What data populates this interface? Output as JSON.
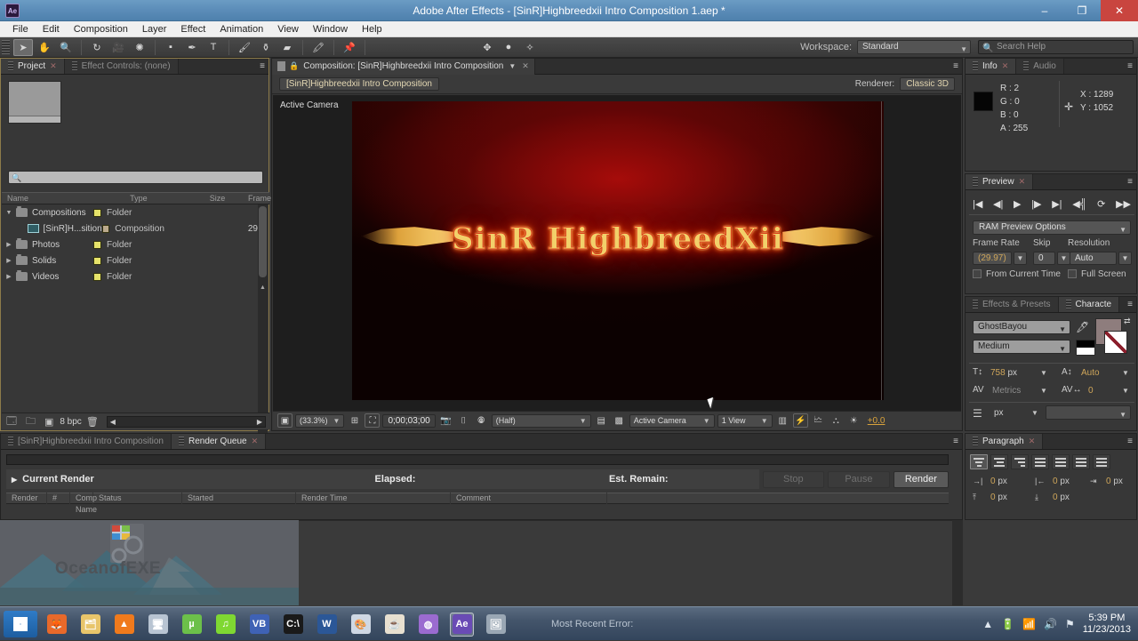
{
  "window": {
    "title": "Adobe After Effects - [SinR]Highbreedxii Intro Composition 1.aep *",
    "app_badge": "Ae",
    "minimize": "–",
    "maximize": "❐",
    "close": "✕"
  },
  "menubar": {
    "items": [
      "File",
      "Edit",
      "Composition",
      "Layer",
      "Effect",
      "Animation",
      "View",
      "Window",
      "Help"
    ]
  },
  "toolbar": {
    "tools": [
      {
        "name": "selection-tool",
        "glyph": "➤",
        "selected": true
      },
      {
        "name": "hand-tool",
        "glyph": "✋",
        "selected": false
      },
      {
        "name": "zoom-tool",
        "glyph": "🔍",
        "selected": false
      },
      {
        "name": "rotation-tool",
        "glyph": "↻",
        "selected": false
      },
      {
        "name": "camera-tool",
        "glyph": "🎥",
        "selected": false
      },
      {
        "name": "pan-behind-tool",
        "glyph": "✺",
        "selected": false
      },
      {
        "name": "shape-tool",
        "glyph": "▪",
        "selected": false
      },
      {
        "name": "pen-tool",
        "glyph": "✒",
        "selected": false
      },
      {
        "name": "type-tool",
        "glyph": "T",
        "selected": false
      },
      {
        "name": "brush-tool",
        "glyph": "🖌",
        "selected": false
      },
      {
        "name": "clone-stamp-tool",
        "glyph": "⚱",
        "selected": false
      },
      {
        "name": "eraser-tool",
        "glyph": "▰",
        "selected": false
      },
      {
        "name": "roto-brush-tool",
        "glyph": "🖍",
        "selected": false
      },
      {
        "name": "puppet-pin-tool",
        "glyph": "📌",
        "selected": false
      }
    ],
    "extra_tools": [
      {
        "name": "local-axis-mode-icon",
        "glyph": "✥"
      },
      {
        "name": "world-axis-mode-icon",
        "glyph": "●"
      },
      {
        "name": "view-axis-mode-icon",
        "glyph": "✧"
      }
    ],
    "workspace_label": "Workspace:",
    "workspace_value": "Standard",
    "search_placeholder": "Search Help"
  },
  "project_panel": {
    "tabs": [
      {
        "label": "Project",
        "active": true,
        "closable": true
      },
      {
        "label": "Effect Controls: (none)",
        "active": false,
        "closable": false
      }
    ],
    "search_placeholder": "",
    "columns": [
      "Name",
      "Type",
      "Size",
      "Frame"
    ],
    "rows": [
      {
        "name": "Compositions",
        "type": "Folder",
        "size": "",
        "frame": "",
        "indent": 0,
        "expanded": true,
        "kind": "folder"
      },
      {
        "name": "[SinR]H...sition",
        "type": "Composition",
        "size": "",
        "frame": "29",
        "indent": 1,
        "expanded": false,
        "kind": "comp"
      },
      {
        "name": "Photos",
        "type": "Folder",
        "size": "",
        "frame": "",
        "indent": 0,
        "expanded": false,
        "kind": "folder"
      },
      {
        "name": "Solids",
        "type": "Folder",
        "size": "",
        "frame": "",
        "indent": 0,
        "expanded": false,
        "kind": "folder"
      },
      {
        "name": "Videos",
        "type": "Folder",
        "size": "",
        "frame": "",
        "indent": 0,
        "expanded": false,
        "kind": "folder"
      }
    ],
    "bit_depth": "8 bpc"
  },
  "comp_panel": {
    "tab_label": "Composition: [SinR]Highbreedxii Intro Composition",
    "breadcrumb": "[SinR]Highbreedxii Intro Composition",
    "renderer_label": "Renderer:",
    "renderer_value": "Classic 3D",
    "view_label": "Active Camera",
    "canvas_title": "SinR HighbreedXii",
    "viewer_bar": {
      "zoom": "(33.3%)",
      "timecode": "0;00;03;00",
      "resolution": "(Half)",
      "camera": "Active Camera",
      "views": "1 View",
      "exposure": "+0.0"
    }
  },
  "info_panel": {
    "tabs": [
      {
        "label": "Info",
        "active": true,
        "closable": true
      },
      {
        "label": "Audio",
        "active": false,
        "closable": false
      }
    ],
    "r": "R : 2",
    "g": "G : 0",
    "b": "B : 0",
    "a": "A : 255",
    "x": "X : 1289",
    "y": "Y : 1052"
  },
  "preview_panel": {
    "tab": "Preview",
    "buttons": [
      {
        "name": "first-frame-button",
        "glyph": "|◀"
      },
      {
        "name": "previous-frame-button",
        "glyph": "◀|"
      },
      {
        "name": "play-button",
        "glyph": "▶"
      },
      {
        "name": "next-frame-button",
        "glyph": "|▶"
      },
      {
        "name": "last-frame-button",
        "glyph": "▶|"
      },
      {
        "name": "audio-button",
        "glyph": "◀╣"
      },
      {
        "name": "loop-button",
        "glyph": "⟳"
      },
      {
        "name": "ram-preview-button",
        "glyph": "▶▶"
      }
    ],
    "options_label": "RAM Preview Options",
    "frame_rate_label": "Frame Rate",
    "frame_rate_value": "(29.97)",
    "skip_label": "Skip",
    "skip_value": "0",
    "resolution_label": "Resolution",
    "resolution_value": "Auto",
    "from_current_time": "From Current Time",
    "full_screen": "Full Screen"
  },
  "character_panel": {
    "tabs": [
      {
        "label": "Effects & Presets",
        "active": false,
        "closable": false
      },
      {
        "label": "Characte",
        "active": true,
        "closable": false
      }
    ],
    "font_family": "GhostBayou",
    "font_style": "Medium",
    "font_size": "758",
    "font_size_unit": "px",
    "leading": "Auto",
    "kerning": "Metrics",
    "tracking": "0",
    "stroke_width_unit": "px",
    "fill_color": "#8e7d7d",
    "stroke_color": "#ffffff"
  },
  "paragraph_panel": {
    "tab": "Paragraph",
    "align_buttons": [
      {
        "name": "align-left-button",
        "active": true
      },
      {
        "name": "align-center-button",
        "active": false
      },
      {
        "name": "align-right-button",
        "active": false
      },
      {
        "name": "justify-last-left-button",
        "active": false
      },
      {
        "name": "justify-last-center-button",
        "active": false
      },
      {
        "name": "justify-last-right-button",
        "active": false
      },
      {
        "name": "justify-all-button",
        "active": false
      }
    ],
    "indent_left": "0",
    "indent_right": "0",
    "indent_first": "0",
    "space_before": "0",
    "space_after": "0",
    "unit": "px"
  },
  "render_queue": {
    "tabs": [
      {
        "label": "[SinR]Highbreedxii Intro Composition",
        "active": false,
        "closable": false
      },
      {
        "label": "Render Queue",
        "active": true,
        "closable": true
      }
    ],
    "current_render": "Current Render",
    "elapsed_label": "Elapsed:",
    "remain_label": "Est. Remain:",
    "stop_button": "Stop",
    "pause_button": "Pause",
    "render_button": "Render",
    "columns": [
      "Render",
      "#",
      "Comp Name",
      "Status",
      "Started",
      "Render Time",
      "Comment"
    ]
  },
  "desktop": {
    "watermark": "OceanofEXE"
  },
  "taskbar": {
    "start_name": "start-button",
    "items": [
      {
        "name": "taskbar-firefox",
        "glyph": "🦊",
        "color": "#e8692a",
        "active": false
      },
      {
        "name": "taskbar-file-explorer",
        "glyph": "🗂",
        "color": "#e8c56a",
        "active": false
      },
      {
        "name": "taskbar-vlc",
        "glyph": "▲",
        "color": "#f07a1c",
        "active": false
      },
      {
        "name": "taskbar-media-player",
        "glyph": "🖥",
        "color": "#b8c4d2",
        "active": false
      },
      {
        "name": "taskbar-utorrent",
        "glyph": "µ",
        "color": "#6cc04a",
        "active": false
      },
      {
        "name": "taskbar-spotify",
        "glyph": "♫",
        "color": "#7fd832",
        "active": false
      },
      {
        "name": "taskbar-visual-basic",
        "glyph": "VB",
        "color": "#3f62b5",
        "active": false
      },
      {
        "name": "taskbar-command-prompt",
        "glyph": "C:\\",
        "color": "#1a1a1a",
        "active": false
      },
      {
        "name": "taskbar-word",
        "glyph": "W",
        "color": "#2b5797",
        "active": false
      },
      {
        "name": "taskbar-paint",
        "glyph": "🎨",
        "color": "#cfd8e4",
        "active": false
      },
      {
        "name": "taskbar-java",
        "glyph": "☕",
        "color": "#e8e0d0",
        "active": false
      },
      {
        "name": "taskbar-revo",
        "glyph": "◍",
        "color": "#9b6bd0",
        "active": false
      },
      {
        "name": "taskbar-after-effects",
        "glyph": "Ae",
        "color": "#6a4bb5",
        "active": true
      },
      {
        "name": "taskbar-photo-viewer",
        "glyph": "🖼",
        "color": "#9aa7b4",
        "active": false
      }
    ],
    "error_text": "Most Recent Error:",
    "tray": [
      {
        "name": "show-hidden-icons-icon",
        "glyph": "▲"
      },
      {
        "name": "battery-icon",
        "glyph": "🔋"
      },
      {
        "name": "network-signal-icon",
        "glyph": "▂▄▆"
      },
      {
        "name": "volume-icon",
        "glyph": "🔊"
      },
      {
        "name": "action-center-icon",
        "glyph": "⚑"
      }
    ],
    "time": "5:39 PM",
    "date": "11/23/2013"
  }
}
